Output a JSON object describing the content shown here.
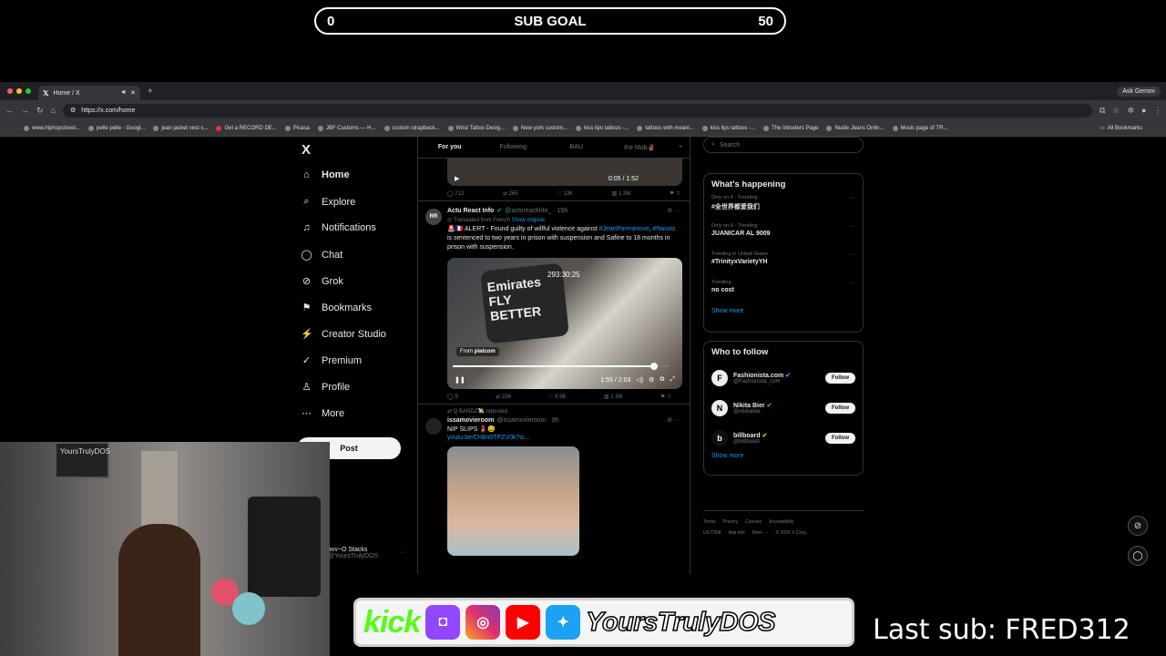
{
  "overlay": {
    "goal_left": "0",
    "goal_title": "SUB GOAL",
    "goal_right": "50",
    "last_sub": "Last sub: FRED312",
    "brand": "YoursTrulyDOS",
    "kick": "kick"
  },
  "browser": {
    "tab_title": "Home / X",
    "gemini": "Ask Gemini",
    "url": "https://x.com/home",
    "bookmarks": [
      "www.hiphopcloset...",
      "pelle pelle - Googl...",
      "jean jacket vest s...",
      "Get a RECORD DE...",
      "Picasa",
      "JBF Customs — H...",
      "custom strapback...",
      "Wrist Tattoo Desig...",
      "New york custom...",
      "kiss lips tattoos -...",
      "tattoos with meani...",
      "kiss lips tattoos -...",
      "The Intruders Page",
      "Nudie Jeans Onlin...",
      "Music page of TR..."
    ],
    "all_bookmarks": "All Bookmarks"
  },
  "nav": {
    "logo": "X",
    "items": [
      {
        "label": "Home",
        "icon": "⌂"
      },
      {
        "label": "Explore",
        "icon": "⌕"
      },
      {
        "label": "Notifications",
        "icon": "♫"
      },
      {
        "label": "Chat",
        "icon": "◯"
      },
      {
        "label": "Grok",
        "icon": "⊘"
      },
      {
        "label": "Bookmarks",
        "icon": "⚑"
      },
      {
        "label": "Creator Studio",
        "icon": "⚡"
      },
      {
        "label": "Premium",
        "icon": "✓"
      },
      {
        "label": "Profile",
        "icon": "♙"
      },
      {
        "label": "More",
        "icon": "⋯"
      }
    ],
    "post": "Post"
  },
  "account": {
    "name": "avv~O Stacks",
    "handle": "@YoursTrulyDOS"
  },
  "feed": {
    "tabs": [
      "For you",
      "Following",
      "BAU",
      "the Mob✌🏾"
    ],
    "video1_time": "0:05 / 1:52",
    "actions1": {
      "replies": "712",
      "reposts": "265",
      "likes": "13K",
      "views": "1.3M"
    },
    "tweet2": {
      "avatar": "RR",
      "name": "Actu React Info",
      "handle": "@actureactinfo_ · 15h",
      "translated": "Translated from French",
      "show_original": "Show original",
      "text_a": "🚨🇫🇷 ALERT - Found guilty of willful violence against ",
      "tag1": "#JeanPormanove",
      "text_b": ", ",
      "tag2": "#Naruto",
      "text_c": " is sentenced to two years in prison with suspension and Safine to 18 months in prison with suspension.",
      "jersey": "Emirates FLY BETTER",
      "stamp": "293:30:25",
      "from": "From",
      "from_src": "platcom",
      "time": "1:55 / 2:03",
      "progress": 0.93,
      "actions": {
        "replies": "5",
        "reposts": "236",
        "likes": "6.9K",
        "views": "1.3M"
      }
    },
    "tweet3": {
      "repost_by": "Q BANDZ💸 reposted",
      "name": "issamovieroom",
      "handle": "@issamovieroom · 9h",
      "text": "NIP SLIPS 💄😅",
      "link": "youtu.be/ChBn0TPZV0k?is..."
    }
  },
  "right": {
    "search": "Search",
    "happening_title": "What's happening",
    "trends": [
      {
        "ctx": "Only on X · Trending",
        "title": "#全世界都爱我们"
      },
      {
        "ctx": "Only on X · Trending",
        "title": "JUANICAR AL 9009"
      },
      {
        "ctx": "Trending in United States",
        "title": "#TrinityxVarietyYH"
      },
      {
        "ctx": "Trending",
        "title": "no cost"
      }
    ],
    "show_more": "Show more",
    "who_title": "Who to follow",
    "who": [
      {
        "name": "Fashionista.com",
        "handle": "@Fashionista_com",
        "av": "F"
      },
      {
        "name": "Nikita Bier",
        "handle": "@nikitabier",
        "av": "N"
      },
      {
        "name": "billboard",
        "handle": "@billboard",
        "av": "b"
      }
    ],
    "follow": "Follow",
    "footer_line1": [
      "Terms",
      "Privacy",
      "Cookies",
      "Accessibility"
    ],
    "footer_line2": [
      "US TIDA",
      "Ads info",
      "More ···",
      "© 2026 X Corp."
    ]
  }
}
